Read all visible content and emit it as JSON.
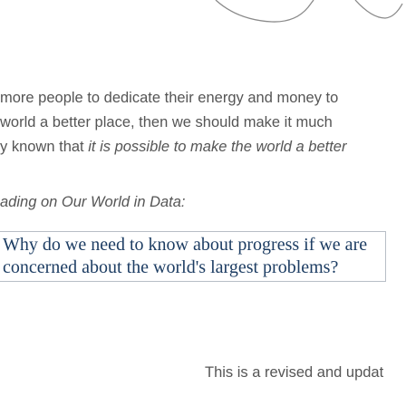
{
  "content": {
    "lines": [
      "more people to dedicate their energy and money to",
      "world a better place, then we should make it much",
      "y known that "
    ],
    "line3_emphasis": "it is possible to make the world a better",
    "reading_heading": "ading on Our World in Data:",
    "article_link": {
      "title_line1": "Why do we need to know about progress if we are",
      "title_line2": "concerned about the world's largest problems?"
    },
    "footer_text": "This is a revised and updat"
  },
  "colors": {
    "body_text": "#555555",
    "link_title": "#1d3d63",
    "link_border": "#b8bec6"
  }
}
